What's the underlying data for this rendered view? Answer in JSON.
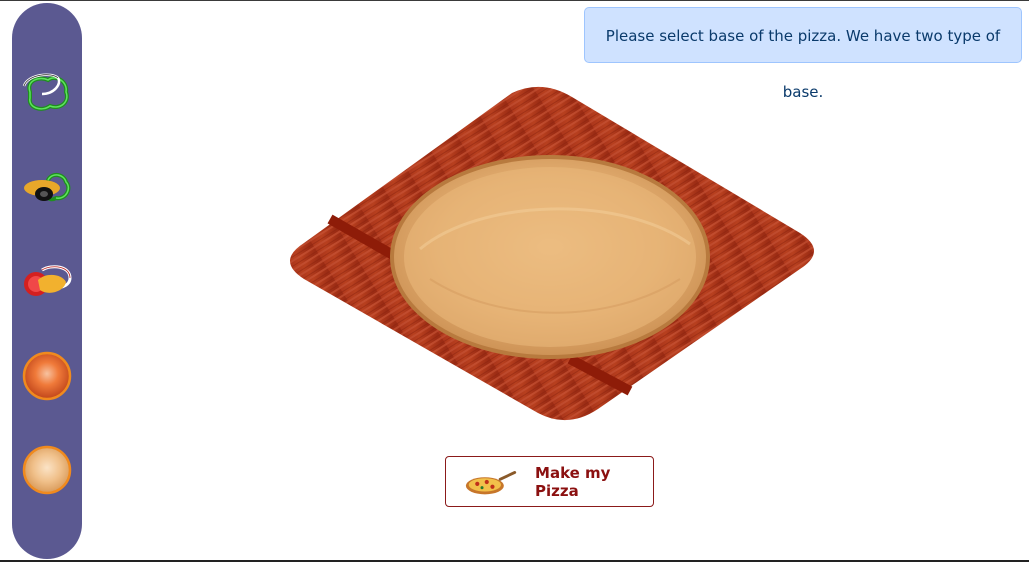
{
  "alert": {
    "message": "Please select base of the pizza. We have two type of base."
  },
  "actions": {
    "make_pizza_label": "Make my Pizza"
  },
  "sidebar": {
    "tools": [
      {
        "icon": "capsicum-onion-icon"
      },
      {
        "icon": "olive-capsicum-icon"
      },
      {
        "icon": "tomato-cheese-icon"
      },
      {
        "icon": "tomato-base-icon"
      },
      {
        "icon": "cheese-base-icon"
      }
    ]
  },
  "colors": {
    "sidebar": "#5b5991",
    "alert_bg": "#cfe2ff",
    "button_text": "#8b1010",
    "board_wood": "#a02a14",
    "plate_wood": "#e6b97a"
  }
}
